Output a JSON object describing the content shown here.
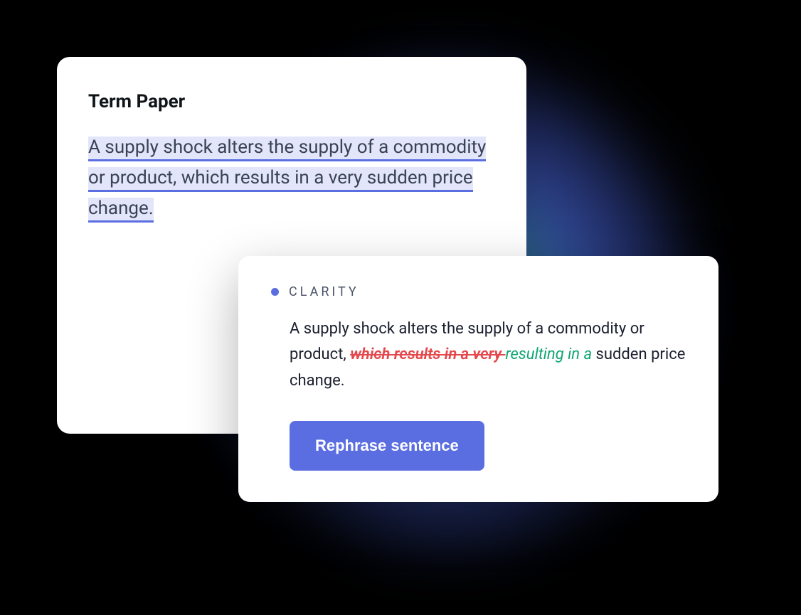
{
  "document": {
    "title": "Term Paper",
    "highlighted_text": "A supply shock alters the supply of a commodity or product, which results in a very sudden price change."
  },
  "suggestion": {
    "category": "CLARITY",
    "text_before": "A supply shock alters the supply of a commodity or product, ",
    "text_strike": "which results in a very ",
    "text_insert": " resulting in a ",
    "text_after": "sudden price change.",
    "action_label": "Rephrase sentence"
  }
}
